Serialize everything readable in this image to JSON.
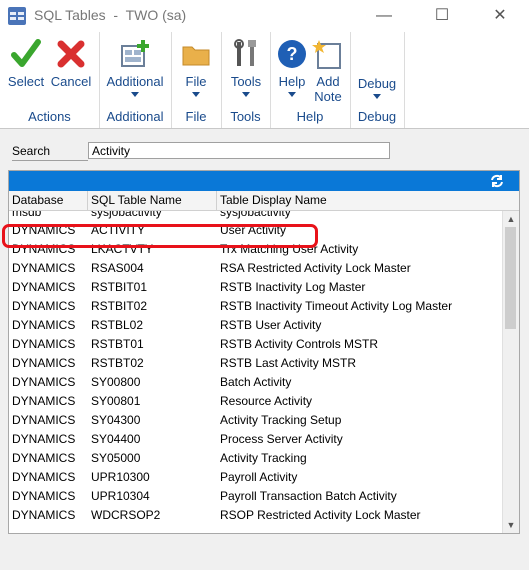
{
  "window": {
    "title": "SQL Tables  -  TWO (sa)",
    "minimize": "—",
    "maximize": "☐",
    "close": "✕"
  },
  "ribbon": {
    "actions": {
      "label": "Actions",
      "select": "Select",
      "cancel": "Cancel"
    },
    "additional": {
      "label": "Additional",
      "button": "Additional"
    },
    "file": {
      "label": "File",
      "button": "File"
    },
    "tools": {
      "label": "Tools",
      "button": "Tools"
    },
    "help": {
      "label": "Help",
      "help_button": "Help",
      "add_note_line1": "Add",
      "add_note_line2": "Note"
    },
    "debug": {
      "label": "Debug",
      "button": "Debug"
    }
  },
  "search": {
    "label": "Search",
    "value": "Activity"
  },
  "grid": {
    "columns": [
      "Database",
      "SQL Table Name",
      "Table Display Name"
    ],
    "partial_row": [
      "msdb",
      "sysjobactivity",
      "sysjobactivity"
    ],
    "rows": [
      [
        "DYNAMICS",
        "ACTIVITY",
        "User Activity"
      ],
      [
        "DYNAMICS",
        "LKACTVTY",
        "Trx Matching User Activity"
      ],
      [
        "DYNAMICS",
        "RSAS004",
        "RSA Restricted Activity Lock Master"
      ],
      [
        "DYNAMICS",
        "RSTBIT01",
        "RSTB Inactivity Log Master"
      ],
      [
        "DYNAMICS",
        "RSTBIT02",
        "RSTB Inactivity Timeout Activity Log Master"
      ],
      [
        "DYNAMICS",
        "RSTBL02",
        "RSTB User Activity"
      ],
      [
        "DYNAMICS",
        "RSTBT01",
        "RSTB Activity Controls MSTR"
      ],
      [
        "DYNAMICS",
        "RSTBT02",
        "RSTB Last Activity MSTR"
      ],
      [
        "DYNAMICS",
        "SY00800",
        "Batch Activity"
      ],
      [
        "DYNAMICS",
        "SY00801",
        "Resource Activity"
      ],
      [
        "DYNAMICS",
        "SY04300",
        "Activity Tracking Setup"
      ],
      [
        "DYNAMICS",
        "SY04400",
        "Process Server Activity"
      ],
      [
        "DYNAMICS",
        "SY05000",
        "Activity Tracking"
      ],
      [
        "DYNAMICS",
        "UPR10300",
        "Payroll Activity"
      ],
      [
        "DYNAMICS",
        "UPR10304",
        "Payroll Transaction Batch Activity"
      ],
      [
        "DYNAMICS",
        "WDCRSOP2",
        "RSOP Restricted Activity Lock Master"
      ]
    ]
  },
  "colors": {
    "accent": "#0a78d7",
    "highlight": "#e8121a",
    "ribbon_text": "#1a4b8c"
  }
}
